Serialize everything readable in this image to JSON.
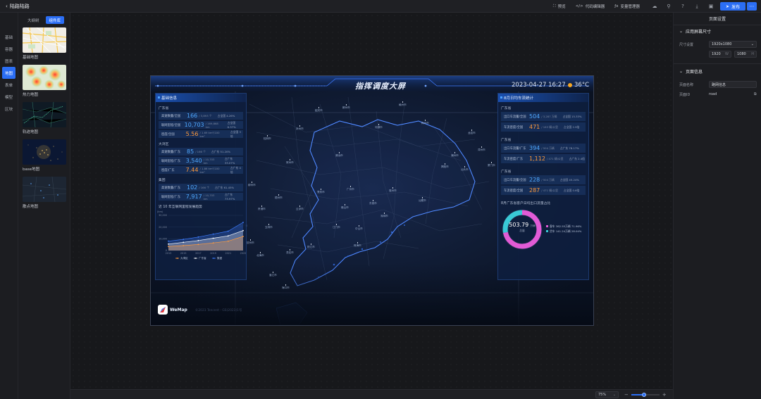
{
  "topbar": {
    "back_label": "陆路陆路",
    "preview": "预览",
    "code_editor": "代码编辑器",
    "var_manager": "变量管理器",
    "publish": "发布"
  },
  "leftrail": {
    "items": [
      "基础",
      "容器",
      "图表",
      "地图",
      "表单",
      "模型",
      "区块"
    ],
    "active_index": 3
  },
  "leftpanel": {
    "tabs": [
      "大纲树",
      "组件库"
    ],
    "active_tab": 1,
    "components": [
      "基础地图",
      "热力地图",
      "轨迹地图",
      "base地图",
      "散点地图"
    ]
  },
  "stage": {
    "title": "指挥调度大屏",
    "datetime": "2023-04-27 16:27",
    "temperature": "36°C",
    "left_panel": {
      "header": "基础信息",
      "sections": [
        {
          "title": "广东省",
          "rows": [
            {
              "label": "高速数量/全国",
              "value": "166",
              "unit": "/ 3,893 个",
              "pct": "占全国 4.26%",
              "color": "blue"
            },
            {
              "label": "联网里程/全国",
              "value": "10,703",
              "unit": "/ 169,868 km",
              "pct": "占全国 6.37%",
              "color": "blue"
            },
            {
              "label": "密度/全国",
              "value": "5.56",
              "unit": "/ 1.69 km²/100 km²",
              "pct": "占全国 3倍",
              "color": "orange"
            }
          ]
        },
        {
          "title": "大湾区",
          "rows": [
            {
              "label": "高速数量/广东",
              "value": "85",
              "unit": "/ 166 个",
              "pct": "占广东 51.20%",
              "color": "blue"
            },
            {
              "label": "联网里程/广东",
              "value": "3,540",
              "unit": "/ 10,703 km",
              "pct": "占广东 33.07%",
              "color": "blue"
            },
            {
              "label": "密度/广东",
              "value": "7.44",
              "unit": "/ 1.86 km²/100 km²",
              "pct": "占广东 4倍",
              "color": "orange"
            }
          ]
        },
        {
          "title": "集团",
          "rows": [
            {
              "label": "高速数量/广东",
              "value": "102",
              "unit": "/ 166 个",
              "pct": "占广东 61.45%",
              "color": "blue"
            },
            {
              "label": "联网里程/广东",
              "value": "7,917",
              "unit": "/ 10,703 km",
              "pct": "占广东 73.97%",
              "color": "blue"
            }
          ]
        }
      ]
    },
    "right_panel": {
      "header": "8月日均车流统计",
      "sections": [
        {
          "title": "广东省",
          "rows": [
            {
              "label": "出口车流量/全国",
              "value": "504",
              "unit": "/ 3,287 万辆",
              "pct": "占全国 15.33%",
              "color": "blue"
            },
            {
              "label": "车流密度/全国",
              "value": "471",
              "unit": "/ 163 辆/公里",
              "pct": "占全国 2.9倍",
              "color": "orange"
            }
          ]
        },
        {
          "title": "广东省",
          "rows": [
            {
              "label": "出口车流量/广东",
              "value": "394",
              "unit": "/ 504 万辆",
              "pct": "占广东 78.17%",
              "color": "blue"
            },
            {
              "label": "车流密度/广东",
              "value": "1,112",
              "unit": "/ 471 辆/公里",
              "pct": "占广东 2.4倍",
              "color": "orange"
            }
          ]
        },
        {
          "title": "广东省",
          "rows": [
            {
              "label": "出口车流量/全国",
              "value": "228",
              "unit": "/ 504 万辆",
              "pct": "占全国 45.24%",
              "color": "blue"
            },
            {
              "label": "车流密度/全国",
              "value": "287",
              "unit": "/ 471 辆/公里",
              "pct": "占全国 0.6倍",
              "color": "orange"
            }
          ]
        }
      ],
      "donut_title": "8月广东省客户日均出口流量占比",
      "donut": {
        "center_value": "503.79",
        "center_unit": "万辆",
        "center_label": "总量",
        "items": [
          {
            "label": "客车",
            "value": "362.55万辆",
            "pct": "71.96%",
            "share": 0.7196,
            "color": "#e25bd6"
          },
          {
            "label": "货车",
            "value": "141.24万辆",
            "pct": "28.04%",
            "share": 0.2804,
            "color": "#39c9d6"
          }
        ]
      }
    },
    "cities": [
      "韶关市",
      "河源市",
      "梅州市",
      "潮州市",
      "汕头市",
      "揭阳市",
      "清远市",
      "肇庆市",
      "广州市",
      "惠州市",
      "汕尾市",
      "东莞市",
      "深圳市",
      "佛山市",
      "江门市",
      "中山市",
      "珠海市",
      "云浮市",
      "阳江市",
      "茂名市",
      "湛江市",
      "柳州市",
      "梧州市",
      "贵港市",
      "玉林市",
      "钦州市",
      "北海市",
      "南宁市",
      "海口市",
      "赣州市",
      "郴州市",
      "永州市",
      "龙岩市",
      "漳州市",
      "厦门市",
      "桂林市",
      "贺州市"
    ],
    "logo_text": "WeMap",
    "copyright": "©2023 Tencent - GS(2023)1号"
  },
  "chart_data": {
    "type": "area",
    "title": "近 10 年互联网里程发展趋势",
    "ylabel": "(km)",
    "x": [
      "2013",
      "2015",
      "2017",
      "2019",
      "2021",
      "2022"
    ],
    "ylim": [
      0,
      30000
    ],
    "yticks": [
      "0",
      "10,000",
      "20,000",
      "30,000"
    ],
    "series": [
      {
        "name": "大湾区",
        "color": "#ff9a3c",
        "values": [
          3500,
          4200,
          5200,
          6500,
          8000,
          12000
        ]
      },
      {
        "name": "广东省",
        "color": "#ffffff",
        "values": [
          5500,
          7000,
          8500,
          10500,
          12500,
          17000
        ]
      },
      {
        "name": "集团",
        "color": "#3d7cff",
        "values": [
          8000,
          9500,
          11500,
          14000,
          16500,
          24000
        ]
      }
    ]
  },
  "rightpanel": {
    "title": "页面设置",
    "section1": "应用屏幕尺寸",
    "size_label": "尺寸设置",
    "size_value": "1920x1080",
    "width": "1920",
    "width_unit": "W",
    "height": "1080",
    "height_unit": "H",
    "section2": "页面信息",
    "name_label": "页面名称",
    "name_value": "路网信息",
    "id_label": "页面ID",
    "id_value": "road"
  },
  "bottombar": {
    "zoom": "75%",
    "zoom_level": 0.45
  }
}
